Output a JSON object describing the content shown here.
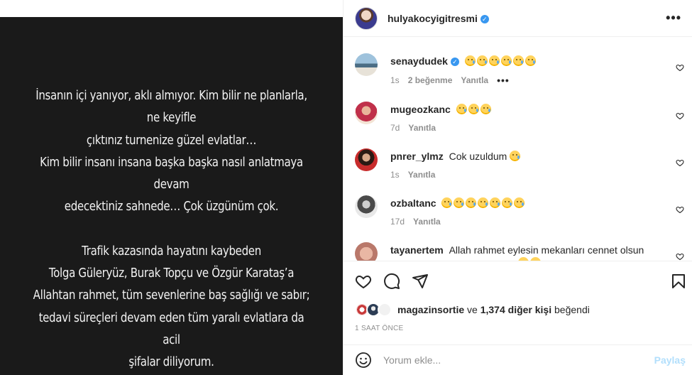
{
  "post": {
    "text_paragraph_1": "İnsanın içi yanıyor, aklı almıyor. Kim bilir ne planlarla, ne keyifle\nçıktınız turnenize güzel evlatlar…\nKim bilir  insanı insana başka başka nasıl anlatmaya devam\nedecektiniz sahnede… Çok üzgünüm çok.",
    "text_paragraph_2": "Trafik kazasında hayatını kaybeden\nTolga Güleryüz, Burak Topçu ve Özgür Karataş’a\nAllahtan rahmet, tüm sevenlerine baş sağlığı ve sabır;\ntedavi süreçleri devam eden tüm yaralı evlatlara da acil\nşifalar diliyorum."
  },
  "header": {
    "username": "hulyakocyigitresmi",
    "verified_mark": "✓",
    "more_label": "•••"
  },
  "comments": [
    {
      "username": "senaydudek",
      "verified": true,
      "text": "",
      "emoji_count": 6,
      "time": "1s",
      "likes": "2 beğenme",
      "reply": "Yanıtla",
      "more": "•••"
    },
    {
      "username": "mugeozkanc",
      "verified": false,
      "text": "",
      "emoji_count": 3,
      "time": "7d",
      "likes": "",
      "reply": "Yanıtla"
    },
    {
      "username": "pnrer_ylmz",
      "verified": false,
      "text": "Cok uzuldum",
      "emoji_count": 1,
      "time": "1s",
      "likes": "",
      "reply": "Yanıtla"
    },
    {
      "username": "ozbaltanc",
      "verified": false,
      "text": "",
      "emoji_count": 7,
      "time": "17d",
      "likes": "",
      "reply": "Yanıtla"
    },
    {
      "username": "tayanertem",
      "verified": false,
      "text": "Allah rahmet eylesin mekanları cennet olsun",
      "emoji_count": 2,
      "time": "",
      "likes": "",
      "reply": ""
    }
  ],
  "likes": {
    "first_user": "magazinsortie",
    "connector": " ve ",
    "others": "1,374 diğer kişi",
    "suffix": " beğendi"
  },
  "timestamp": "1 SAAT ÖNCE",
  "add_comment": {
    "placeholder": "Yorum ekle...",
    "post_label": "Paylaş"
  },
  "icons": {
    "like": "heart-icon",
    "comment": "comment-icon",
    "share": "share-icon",
    "save": "bookmark-icon",
    "emoji": "emoji-icon"
  }
}
